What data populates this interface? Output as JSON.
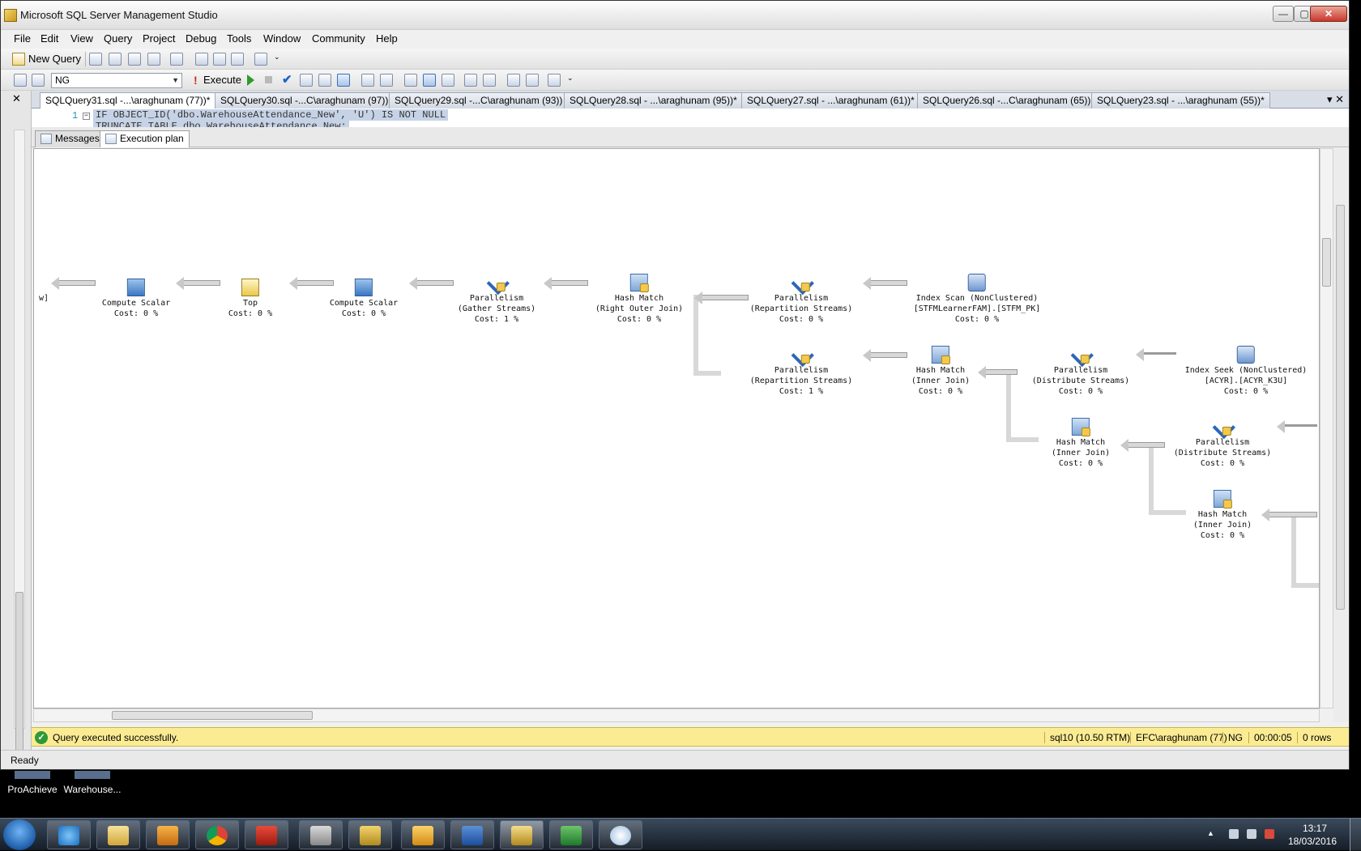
{
  "window": {
    "title": "Microsoft SQL Server Management Studio",
    "minimize": "—",
    "maximize": "▢",
    "close": "✕"
  },
  "menu": [
    "File",
    "Edit",
    "View",
    "Query",
    "Project",
    "Debug",
    "Tools",
    "Window",
    "Community",
    "Help"
  ],
  "toolbar": {
    "new_query": "New Query",
    "database": "NG",
    "execute": "Execute"
  },
  "doc_tabs": [
    "SQLQuery31.sql -...\\araghunam (77))*",
    "SQLQuery30.sql -...C\\araghunam (97))",
    "SQLQuery29.sql -...C\\araghunam (93))",
    "SQLQuery28.sql - ...\\araghunam (95))*",
    "SQLQuery27.sql - ...\\araghunam (61))*",
    "SQLQuery26.sql -...C\\araghunam (65))",
    "SQLQuery23.sql - ...\\araghunam (55))*"
  ],
  "editor": {
    "line_number": "1",
    "line1": "IF OBJECT_ID('dbo.WarehouseAttendance_New', 'U') IS NOT NULL",
    "line2": "TRUNCATE TABLE dbo.WarehouseAttendance_New;"
  },
  "result_tabs": {
    "messages": "Messages",
    "execution_plan": "Execution plan"
  },
  "plan": {
    "edge_fragment": "w]",
    "nodes": [
      {
        "id": "compute1",
        "line1": "Compute Scalar",
        "line2": "",
        "cost": "Cost: 0 %",
        "icon": "compute-scalar-icon"
      },
      {
        "id": "top",
        "line1": "Top",
        "line2": "",
        "cost": "Cost: 0 %",
        "icon": "top-icon"
      },
      {
        "id": "compute2",
        "line1": "Compute Scalar",
        "line2": "",
        "cost": "Cost: 0 %",
        "icon": "compute-scalar-icon"
      },
      {
        "id": "par_gather",
        "line1": "Parallelism",
        "line2": "(Gather Streams)",
        "cost": "Cost: 1 %",
        "icon": "parallelism-icon"
      },
      {
        "id": "hash_right",
        "line1": "Hash Match",
        "line2": "(Right Outer Join)",
        "cost": "Cost: 0 %",
        "icon": "hash-match-icon"
      },
      {
        "id": "par_rep1",
        "line1": "Parallelism",
        "line2": "(Repartition Streams)",
        "cost": "Cost: 0 %",
        "icon": "parallelism-icon"
      },
      {
        "id": "index_scan",
        "line1": "Index Scan (NonClustered)",
        "line2": "[STFMLearnerFAM].[STFM_PK]",
        "cost": "Cost: 0 %",
        "icon": "index-scan-icon"
      },
      {
        "id": "par_rep2",
        "line1": "Parallelism",
        "line2": "(Repartition Streams)",
        "cost": "Cost: 1 %",
        "icon": "parallelism-icon"
      },
      {
        "id": "hash_inner1",
        "line1": "Hash Match",
        "line2": "(Inner Join)",
        "cost": "Cost: 0 %",
        "icon": "hash-match-icon"
      },
      {
        "id": "par_dist1",
        "line1": "Parallelism",
        "line2": "(Distribute Streams)",
        "cost": "Cost: 0 %",
        "icon": "parallelism-icon"
      },
      {
        "id": "index_seek",
        "line1": "Index Seek (NonClustered)",
        "line2": "[ACYR].[ACYR_K3U]",
        "cost": "Cost: 0 %",
        "icon": "index-seek-icon"
      },
      {
        "id": "hash_inner2",
        "line1": "Hash Match",
        "line2": "(Inner Join)",
        "cost": "Cost: 0 %",
        "icon": "hash-match-icon"
      },
      {
        "id": "par_dist2",
        "line1": "Parallelism",
        "line2": "(Distribute Streams)",
        "cost": "Cost: 0 %",
        "icon": "parallelism-icon"
      },
      {
        "id": "hash_inner3",
        "line1": "Hash Match",
        "line2": "(Inner Join)",
        "cost": "Cost: 0 %",
        "icon": "hash-match-icon"
      }
    ]
  },
  "status": {
    "message": "Query executed successfully.",
    "server": "sql10 (10.50 RTM)",
    "user": "EFC\\araghunam (77)",
    "database": "NG",
    "elapsed": "00:00:05",
    "rows": "0 rows"
  },
  "ready": "Ready",
  "desktop_icons": [
    "ProAchieve",
    "Warehouse..."
  ],
  "taskbar": {
    "apps": [
      "internet-explorer",
      "file-explorer",
      "media-player",
      "chrome",
      "acrobat",
      "tool-app",
      "ssms-tools",
      "outlook",
      "word",
      "ssms",
      "excel",
      "paint"
    ],
    "time": "13:17",
    "date": "18/03/2016"
  }
}
